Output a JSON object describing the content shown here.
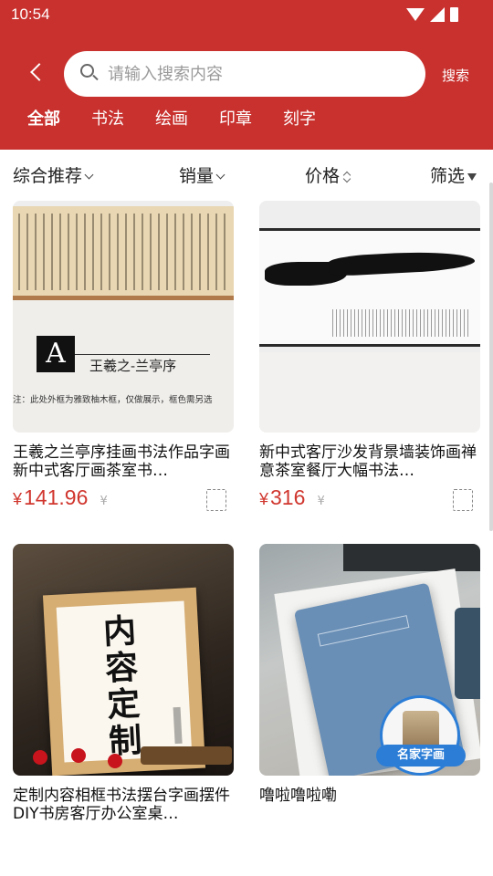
{
  "status_bar": {
    "time": "10:54"
  },
  "search": {
    "placeholder": "请输入搜索内容",
    "button_label": "搜索"
  },
  "categories": [
    {
      "label": "全部",
      "active": true
    },
    {
      "label": "书法",
      "active": false
    },
    {
      "label": "绘画",
      "active": false
    },
    {
      "label": "印章",
      "active": false
    },
    {
      "label": "刻字",
      "active": false
    }
  ],
  "sort": {
    "comprehensive": "综合推荐",
    "sales": "销量",
    "price": "价格",
    "filter": "筛选"
  },
  "theme": {
    "header_bg": "#c8312e",
    "price_color": "#d0362e",
    "badge_blue": "#2b7dd6"
  },
  "products": [
    {
      "title": "王羲之兰亭序挂画书法作品字画新中式客厅画茶室书…",
      "price_symbol": "¥",
      "price": "141.96",
      "original_price": "¥",
      "image_caption_badge": "A",
      "image_caption_name": "王羲之-兰亭序",
      "image_caption_note": "注：此处外框为雅致柚木框，仅做展示，框色需另选"
    },
    {
      "title": "新中式客厅沙发背景墙装饰画禅意茶室餐厅大幅书法…",
      "price_symbol": "¥",
      "price": "316",
      "original_price": "¥"
    },
    {
      "title": "定制内容相框书法摆台字画摆件DIY书房客厅办公室桌…",
      "image_text": "内容定制"
    },
    {
      "title": "噜啦噜啦嘞",
      "badge_label": "名家字画"
    }
  ]
}
